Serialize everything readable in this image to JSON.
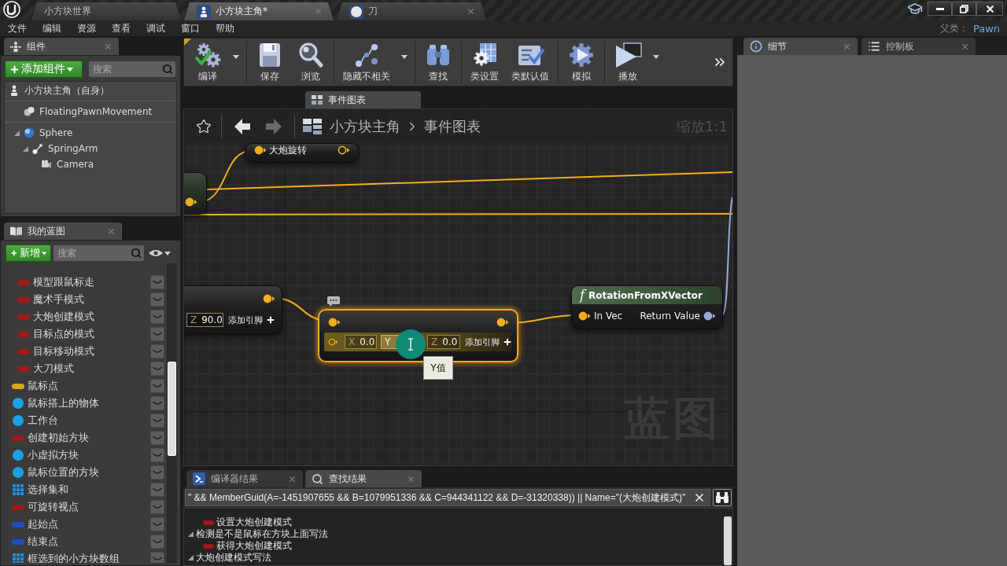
{
  "title_bar": {
    "tabs": [
      {
        "label": "小方块世界",
        "kind": "level",
        "selected": false,
        "closable": false
      },
      {
        "label": "小方块主角*",
        "kind": "blueprint",
        "selected": true,
        "closable": true
      },
      {
        "label": "刀",
        "kind": "material",
        "selected": false,
        "closable": true
      }
    ]
  },
  "menu_bar": {
    "items": [
      "文件",
      "编辑",
      "资源",
      "查看",
      "调试",
      "窗口",
      "帮助"
    ],
    "parent_class_label": "父类：",
    "parent_class": "Pawn"
  },
  "components_panel": {
    "tab": "组件",
    "add_button": "添加组件",
    "search": {
      "placeholder": "搜索"
    },
    "components": [
      {
        "label": "小方块主角（自身）",
        "kind": "self"
      },
      {
        "label": "FloatingPawnMovement",
        "kind": "movement"
      },
      {
        "label": "Sphere",
        "kind": "sphere",
        "expanded": true,
        "children": [
          {
            "label": "SpringArm",
            "kind": "spring_arm",
            "expanded": true,
            "children": [
              {
                "label": "Camera",
                "kind": "camera"
              }
            ]
          }
        ]
      }
    ]
  },
  "my_blueprint_panel": {
    "tab": "我的蓝图",
    "new_button": "新增",
    "search": {
      "placeholder": "搜索"
    },
    "variables": [
      {
        "kind": "group",
        "children": [
          {
            "label": "模型跟鼠标走",
            "kind": "pill",
            "color": "#a01818",
            "public": false
          },
          {
            "label": "魔术手模式",
            "kind": "pill",
            "color": "#a01818",
            "public": false
          },
          {
            "label": "大炮创建模式",
            "kind": "pill",
            "color": "#a01818",
            "public": false
          },
          {
            "label": "目标点的模式",
            "kind": "pill",
            "color": "#a01818",
            "public": false
          },
          {
            "label": "目标移动模式",
            "kind": "pill",
            "color": "#a01818",
            "public": false
          },
          {
            "label": "大刀模式",
            "kind": "pill",
            "color": "#a01818",
            "public": false
          }
        ]
      },
      {
        "label": "鼠标点",
        "kind": "pill",
        "color": "#d8a51c",
        "public": false
      },
      {
        "label": "鼠标搭上的物体",
        "kind": "sphere",
        "color": "#1aa0e6",
        "public": false
      },
      {
        "label": "工作台",
        "kind": "sphere",
        "color": "#1aa0e6",
        "public": false
      },
      {
        "label": "创建初始方块",
        "kind": "pill",
        "color": "#a01818",
        "public": false
      },
      {
        "label": "小虚拟方块",
        "kind": "sphere",
        "color": "#1aa0e6",
        "public": false
      },
      {
        "label": "鼠标位置的方块",
        "kind": "sphere",
        "color": "#1aa0e6",
        "public": false
      },
      {
        "label": "选择集和",
        "kind": "grid",
        "color": "#1f8fe0",
        "public": false
      },
      {
        "label": "可旋转视点",
        "kind": "pill",
        "color": "#a01818",
        "public": false
      },
      {
        "label": "起始点",
        "kind": "pill",
        "color": "#1c4fc4",
        "public": false
      },
      {
        "label": "结束点",
        "kind": "pill",
        "color": "#1c4fc4",
        "public": false
      },
      {
        "label": "框选到的小方块数组",
        "kind": "grid",
        "color": "#1f8fe0",
        "public": false
      }
    ]
  },
  "toolbar": {
    "groups": [
      [
        {
          "label": "编译",
          "kind": "compile",
          "dropdown": true
        }
      ],
      [
        {
          "label": "保存",
          "kind": "save"
        },
        {
          "label": "浏览",
          "kind": "browse"
        }
      ],
      [
        {
          "label": "隐藏不相关",
          "kind": "hide_unrelated",
          "dropdown": true
        }
      ],
      [
        {
          "label": "查找",
          "kind": "find"
        }
      ],
      [
        {
          "label": "类设置",
          "kind": "class_settings"
        },
        {
          "label": "类默认值",
          "kind": "class_defaults"
        }
      ],
      [
        {
          "label": "模拟",
          "kind": "simulate"
        }
      ],
      [
        {
          "label": "播放",
          "kind": "play",
          "dropdown": true
        }
      ]
    ]
  },
  "graph_tabs": [
    {
      "label": "事件图表",
      "selected": true
    }
  ],
  "graph": {
    "navigation": {
      "back_disabled": false,
      "forward_disabled": true
    },
    "breadcrumb": [
      "小方块主角",
      "事件图表"
    ],
    "zoom": "缩放1:1",
    "graph_type_label": "蓝图",
    "nodes": [
      {
        "kind": "variable_set",
        "title": "大炮旋转",
        "selected": false,
        "input_connected": true,
        "output_connected": false
      },
      {
        "kind": "fragment",
        "selected": false,
        "output_connected": true
      },
      {
        "kind": "make",
        "selected": false,
        "output_connected": true,
        "fields": [
          {
            "axis": "Z",
            "value": "90.0"
          }
        ],
        "add_pin": "添加引脚"
      },
      {
        "kind": "make",
        "selected": true,
        "input_connected": true,
        "output_connected": true,
        "element_connected": false,
        "fields": [
          {
            "axis": "X",
            "value": "0.0"
          },
          {
            "axis": "Y",
            "editing": true
          },
          {
            "axis": "Z",
            "value": "0.0"
          }
        ],
        "add_pin": "添加引脚"
      },
      {
        "kind": "function",
        "glyph": "f",
        "title": "RotationFromXVector",
        "selected": false,
        "input": "In Vec",
        "input_connected": true,
        "output": "Return Value",
        "output_connected": true
      }
    ],
    "tooltip": "Y值"
  },
  "bottom_panel": {
    "tabs": [
      {
        "label": "编译器结果",
        "kind": "compiler",
        "selected": false
      },
      {
        "label": "查找结果",
        "kind": "find",
        "selected": true
      }
    ],
    "search": {
      "value": "\" && MemberGuid(A=-1451907655 && B=1079951336 && C=944341122 && D=-31320338)) || Name=\"(大炮创建模式)\""
    },
    "results": [
      {
        "kind": "group",
        "children": [
          {
            "label": "设置大炮创建模式",
            "kind": "variable"
          }
        ]
      },
      {
        "label": "检测是不是鼠标在方块上面写法",
        "kind": "graph",
        "expanded": true,
        "children": [
          {
            "label": "获得大炮创建模式",
            "kind": "variable"
          }
        ]
      },
      {
        "label": "大炮创建模式写法",
        "kind": "graph",
        "expanded": true
      }
    ]
  },
  "details_panel": {
    "tabs": [
      {
        "label": "细节",
        "kind": "details",
        "selected": true
      },
      {
        "label": "控制板",
        "kind": "palette",
        "selected": false
      }
    ]
  }
}
